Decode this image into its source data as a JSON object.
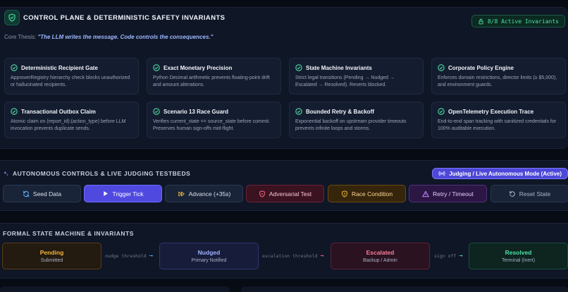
{
  "header": {
    "title": "CONTROL PLANE & DETERMINISTIC SAFETY INVARIANTS",
    "badge": "8/8 Active Invariants",
    "thesis_label": "Core Thesis:",
    "thesis_quote": "\"The LLM writes the message. Code controls the consequences.\""
  },
  "invariants": [
    {
      "title": "Deterministic Recipient Gate",
      "desc": "ApproverRegistry hierarchy check blocks unauthorized or hallucinated recipients."
    },
    {
      "title": "Exact Monetary Precision",
      "desc": "Python Decimal arithmetic prevents floating-point drift and amount alterations."
    },
    {
      "title": "State Machine Invariants",
      "desc": "Strict legal transitions (Pending → Nudged → Escalated → Resolved). Reverts blocked."
    },
    {
      "title": "Corporate Policy Engine",
      "desc": "Enforces domain restrictions, director limits (≥ $5,000), and environment guards."
    },
    {
      "title": "Transactional Outbox Claim",
      "desc": "Atomic claim on (report_id):(action_type) before LLM invocation prevents duplicate sends."
    },
    {
      "title": "Scenario 13 Race Guard",
      "desc": "Verifies current_state == source_state before commit. Preserves human sign-offs mid-flight."
    },
    {
      "title": "Bounded Retry & Backoff",
      "desc": "Exponential backoff on upstream provider timeouts prevents infinite loops and storms."
    },
    {
      "title": "OpenTelemetry Execution Trace",
      "desc": "End-to-end span tracking with sanitized credentials for 100% auditable execution."
    }
  ],
  "controls": {
    "title": "AUTONOMOUS CONTROLS & LIVE JUDGING TESTBEDS",
    "mode_label": "Judging / Live Autonomous Mode (Active)",
    "buttons": [
      {
        "label": "Seed Data",
        "icon": "refresh-icon"
      },
      {
        "label": "Trigger Tick",
        "icon": "play-icon"
      },
      {
        "label": "Advance (+35s)",
        "icon": "fast-forward-icon"
      },
      {
        "label": "Adversarial Test",
        "icon": "shield-icon"
      },
      {
        "label": "Race Condition",
        "icon": "shield-alert-icon"
      },
      {
        "label": "Retry / Timeout",
        "icon": "warning-icon"
      },
      {
        "label": "Reset State",
        "icon": "reset-icon"
      }
    ]
  },
  "state_machine": {
    "title": "FORMAL STATE MACHINE & INVARIANTS",
    "states": [
      {
        "name": "Pending",
        "sub": "Submitted"
      },
      {
        "name": "Nudged",
        "sub": "Primary Notified"
      },
      {
        "name": "Escalated",
        "sub": "Backup / Admin"
      },
      {
        "name": "Resolved",
        "sub": "Terminal (Inert)"
      }
    ],
    "transitions": [
      {
        "label": "nudge threshold"
      },
      {
        "label": "escalation threshold"
      },
      {
        "label": "sign off"
      }
    ]
  }
}
